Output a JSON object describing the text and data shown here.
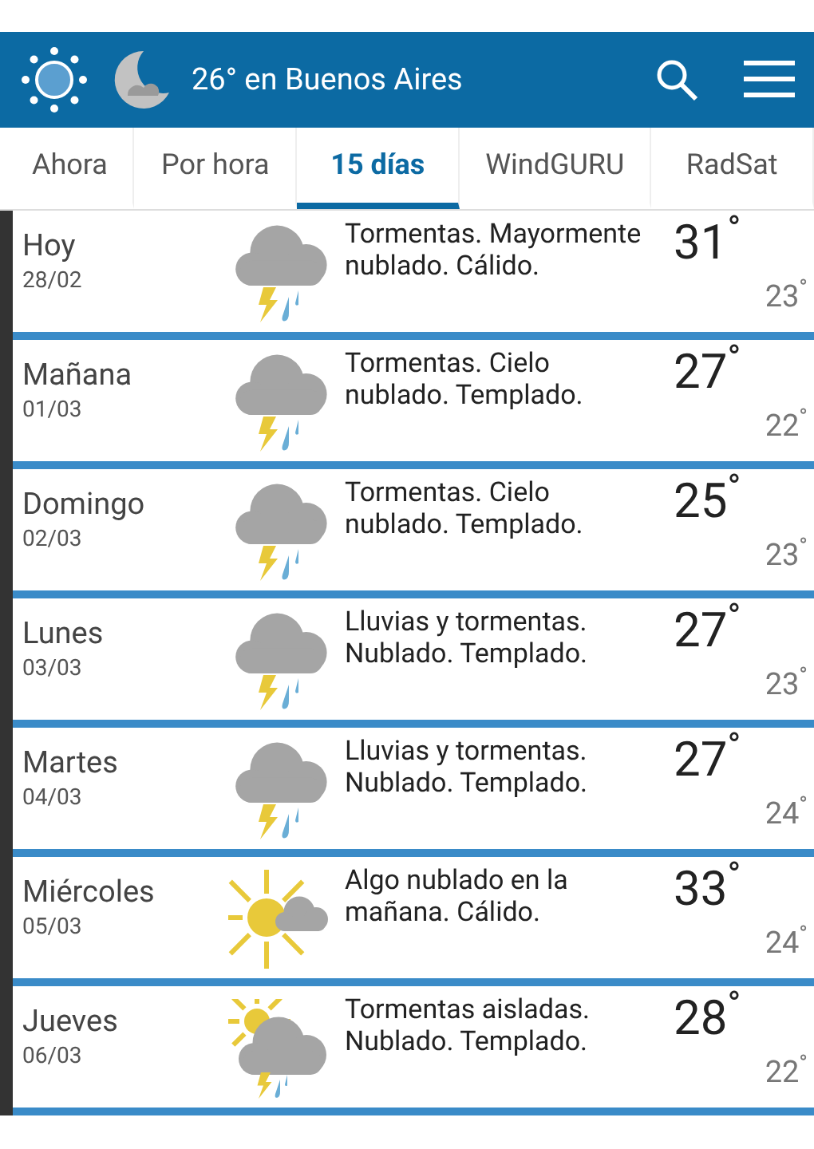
{
  "header": {
    "title": "26° en Buenos Aires"
  },
  "tabs": [
    {
      "label": "Ahora",
      "selected": false
    },
    {
      "label": "Por hora",
      "selected": false
    },
    {
      "label": "15 días",
      "selected": true
    },
    {
      "label": "WindGURU",
      "selected": false
    },
    {
      "label": "RadSat",
      "selected": false
    }
  ],
  "days": [
    {
      "day": "Hoy",
      "date": "28/02",
      "kind": "storm",
      "description": "Tormentas. Mayormente nublado. Cálido.",
      "high": "31$^{°}$",
      "low": "23$^{°}$"
    },
    {
      "day": "Mañana",
      "date": "01/03",
      "kind": "storm",
      "description": "Tormentas. Cielo nublado. Templado.",
      "high": "27$^{°}$",
      "low": "22$^{°}$"
    },
    {
      "day": "Domingo",
      "date": "02/03",
      "kind": "storm",
      "description": "Tormentas. Cielo nublado. Templado.",
      "high": "25$^{°}$",
      "low": "23$^{°}$"
    },
    {
      "day": "Lunes",
      "date": "03/03",
      "kind": "storm",
      "description": "Lluvias y tormentas. Nublado. Templado.",
      "high": "27$^{°}$",
      "low": "23$^{°}$"
    },
    {
      "day": "Martes",
      "date": "04/03",
      "kind": "storm",
      "description": "Lluvias y tormentas. Nublado. Templado.",
      "high": "27$^{°}$",
      "low": "24$^{°}$"
    },
    {
      "day": "Miércoles",
      "date": "05/03",
      "kind": "sun_cloud",
      "description": "Algo nublado en la mañana. Cálido.",
      "high": "33$^{°}$",
      "low": "24$^{°}$"
    },
    {
      "day": "Jueves",
      "date": "06/03",
      "kind": "sun_storm",
      "description": "Tormentas aisladas. Nublado. Templado.",
      "high": "28$^{°}$",
      "low": "22$^{°}$"
    }
  ]
}
